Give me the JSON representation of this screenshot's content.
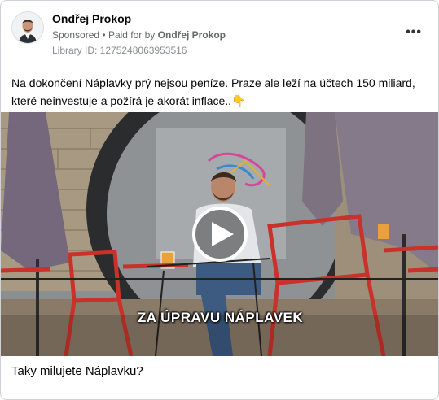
{
  "post": {
    "author": "Ondřej Prokop",
    "sponsored": "Sponsored",
    "paid_for_prefix": "Paid for by",
    "paid_for_name": "Ondřej Prokop",
    "library_id": "Library ID: 1275248063953516",
    "body_line1": "Na dokončení Náplavky prý nejsou peníze. Praze ale leží na účtech 150 miliard,",
    "body_line2": "které neinvestuje a požírá je akorát inflace..",
    "emoji": "👇",
    "more_icon": "more-options-icon",
    "video_caption": "ZA ÚPRAVU NÁPLAVEK",
    "footer": "Taky milujete Náplavku?"
  },
  "colors": {
    "text": "#050505",
    "meta": "#65676b",
    "chair_red": "#c8322b",
    "umbrella": "#7a6f7f"
  }
}
